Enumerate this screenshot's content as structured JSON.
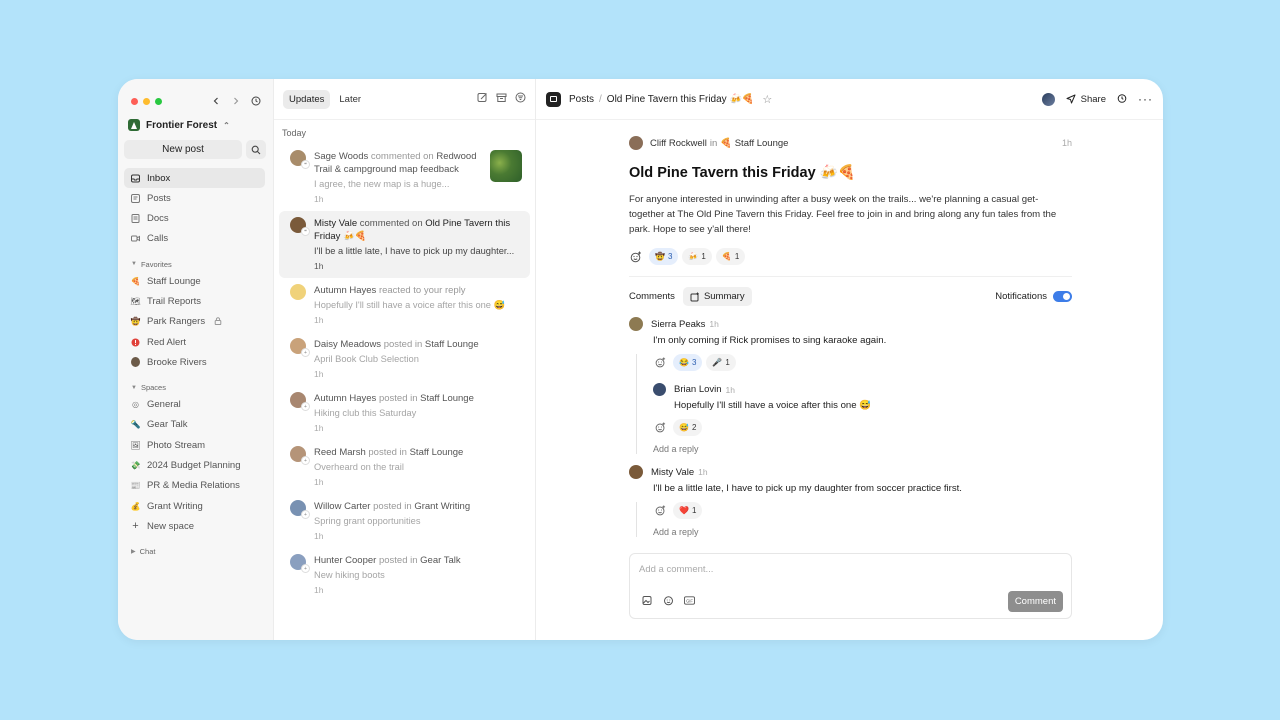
{
  "sidebar": {
    "org_name": "Frontier Forest",
    "new_post": "New post",
    "nav": [
      {
        "label": "Inbox",
        "icon": "inbox-icon"
      },
      {
        "label": "Posts",
        "icon": "posts-icon"
      },
      {
        "label": "Docs",
        "icon": "docs-icon"
      },
      {
        "label": "Calls",
        "icon": "calls-icon"
      }
    ],
    "favorites_label": "Favorites",
    "favorites": [
      {
        "label": "Staff Lounge",
        "emoji": "🍕"
      },
      {
        "label": "Trail Reports",
        "emoji": "🗺"
      },
      {
        "label": "Park Rangers",
        "emoji": "🤠"
      },
      {
        "label": "Red Alert",
        "emoji": "🛑"
      },
      {
        "label": "Brooke Rivers",
        "emoji": ""
      }
    ],
    "spaces_label": "Spaces",
    "spaces": [
      {
        "label": "General",
        "emoji": "◎"
      },
      {
        "label": "Gear Talk",
        "emoji": "🔦"
      },
      {
        "label": "Photo Stream",
        "emoji": "🖼"
      },
      {
        "label": "2024 Budget Planning",
        "emoji": "💸"
      },
      {
        "label": "PR & Media Relations",
        "emoji": "📰"
      },
      {
        "label": "Grant Writing",
        "emoji": "💰"
      },
      {
        "label": "New space",
        "emoji": "+"
      }
    ],
    "chat_label": "Chat"
  },
  "feed": {
    "tabs": [
      "Updates",
      "Later"
    ],
    "today": "Today",
    "items": [
      {
        "actor": "Sage Woods",
        "action": " commented on ",
        "target": "Redwood Trail & campground map feedback",
        "snippet": "I agree, the new map is a huge...",
        "time": "1h",
        "avatar": "#a88c6a",
        "badge": "❝"
      },
      {
        "actor": "Misty Vale",
        "action": " commented on ",
        "target": "Old Pine Tavern this Friday 🍻🍕",
        "snippet": "I'll be a little late, I have to pick up my daughter...",
        "time": "1h",
        "avatar": "#7a5a3a",
        "badge": "❝"
      },
      {
        "actor": "Autumn Hayes",
        "action": " reacted to your reply",
        "target": "",
        "snippet": "Hopefully I'll still have a voice after this one 😅",
        "time": "1h",
        "avatar": "#f0d27a",
        "badge": ""
      },
      {
        "actor": "Daisy Meadows",
        "action": " posted in ",
        "target": "Staff Lounge",
        "snippet": "April Book Club Selection",
        "time": "1h",
        "avatar": "#c9a27a",
        "badge": "+"
      },
      {
        "actor": "Autumn Hayes",
        "action": " posted in ",
        "target": "Staff Lounge",
        "snippet": "Hiking club this Saturday",
        "time": "1h",
        "avatar": "#a88770",
        "badge": "+"
      },
      {
        "actor": "Reed Marsh",
        "action": " posted in ",
        "target": "Staff Lounge",
        "snippet": "Overheard on the trail",
        "time": "1h",
        "avatar": "#b59478",
        "badge": "+"
      },
      {
        "actor": "Willow Carter",
        "action": " posted in ",
        "target": "Grant Writing",
        "snippet": "Spring grant opportunities",
        "time": "1h",
        "avatar": "#7891b2",
        "badge": "+"
      },
      {
        "actor": "Hunter Cooper",
        "action": " posted in ",
        "target": "Gear Talk",
        "snippet": "New hiking boots",
        "time": "1h",
        "avatar": "#8a9fbf",
        "badge": "+"
      }
    ]
  },
  "main": {
    "breadcrumb_root": "Posts",
    "breadcrumb_current": "Old Pine Tavern this Friday 🍻🍕",
    "share": "Share",
    "post": {
      "author": "Cliff Rockwell",
      "in": "in",
      "space": "🍕 Staff Lounge",
      "time": "1h",
      "title": "Old Pine Tavern this Friday 🍻🍕",
      "body": "For anyone interested in unwinding after a busy week on the trails... we're planning a casual get-together at The Old Pine Tavern this Friday. Feel free to join in and bring along any fun tales from the park. Hope to see y'all there!",
      "reactions": [
        {
          "emoji": "🤠",
          "count": "3",
          "mine": true
        },
        {
          "emoji": "🍻",
          "count": "1",
          "mine": false
        },
        {
          "emoji": "🍕",
          "count": "1",
          "mine": false
        }
      ]
    },
    "comments_label": "Comments",
    "summary_label": "Summary",
    "notifications_label": "Notifications",
    "comments": [
      {
        "name": "Sierra Peaks",
        "time": "1h",
        "text": "I'm only coming if Rick promises to sing karaoke again.",
        "avatar": "#8d7a52",
        "reactions": [
          {
            "emoji": "😂",
            "count": "3",
            "mine": true
          },
          {
            "emoji": "🎤",
            "count": "1",
            "mine": false
          }
        ],
        "reply": {
          "name": "Brian Lovin",
          "time": "1h",
          "text": "Hopefully I'll still have a voice after this one 😅",
          "avatar": "#3a4d6e",
          "reactions": [
            {
              "emoji": "😅",
              "count": "2",
              "mine": false
            }
          ]
        }
      },
      {
        "name": "Misty Vale",
        "time": "1h",
        "text": "I'll be a little late, I have to pick up my daughter from soccer practice first.",
        "avatar": "#7a5a3a",
        "reactions": [
          {
            "emoji": "❤️",
            "count": "1",
            "mine": false
          }
        ],
        "reply": null
      }
    ],
    "add_reply": "Add a reply",
    "composer_placeholder": "Add a comment...",
    "comment_button": "Comment"
  }
}
